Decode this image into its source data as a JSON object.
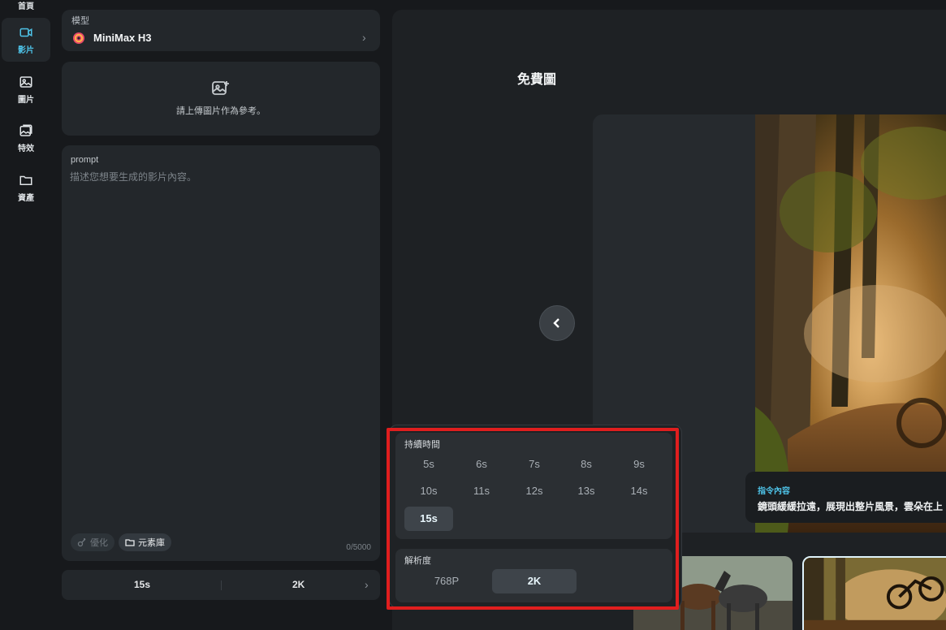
{
  "nav": {
    "items": [
      {
        "label": "首頁",
        "icon": "home-icon",
        "active": false
      },
      {
        "label": "影片",
        "icon": "video-icon",
        "active": true
      },
      {
        "label": "圖片",
        "icon": "image-icon",
        "active": false
      },
      {
        "label": "特效",
        "icon": "effects-icon",
        "active": false
      },
      {
        "label": "資產",
        "icon": "folder-icon",
        "active": false
      }
    ]
  },
  "model": {
    "caption": "模型",
    "name": "MiniMax H3"
  },
  "upload": {
    "text": "請上傳圖片作為參考。"
  },
  "prompt": {
    "title": "prompt",
    "placeholder": "描述您想要生成的影片內容。",
    "optimize_label": "優化",
    "library_label": "元素庫",
    "counter": "0/5000"
  },
  "bottom_bar": {
    "duration": "15s",
    "resolution": "2K"
  },
  "main": {
    "title": "免費圖",
    "caption_label": "指令內容",
    "caption_text": "鏡頭緩緩拉遠，展現出整片風景，雲朵在上"
  },
  "popup": {
    "duration_title": "持續時間",
    "durations": [
      "5s",
      "6s",
      "7s",
      "8s",
      "9s",
      "10s",
      "11s",
      "12s",
      "13s",
      "14s",
      "15s"
    ],
    "selected_duration": "15s",
    "resolution_title": "解析度",
    "resolutions": [
      "768P",
      "2K"
    ],
    "selected_resolution": "2K"
  },
  "colors": {
    "accent": "#4ec3e8",
    "highlight": "#e01e1e",
    "background": "#17191c",
    "card": "#23272b"
  }
}
